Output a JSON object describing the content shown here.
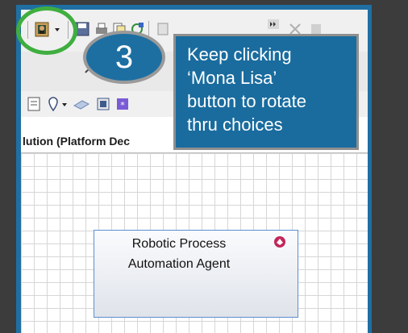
{
  "step": {
    "number": "3"
  },
  "callout": {
    "lines": [
      "Keep clicking",
      "‘Mona Lisa’",
      "button to rotate",
      "thru choices"
    ]
  },
  "diagram": {
    "tab_title": "lution (Platform Dec",
    "node": {
      "lines": [
        "Robotic Process",
        "Automation Agent"
      ]
    }
  },
  "icons": {
    "mona_lisa": "mona-lisa-icon",
    "node_badge": "application-component-icon"
  },
  "colors": {
    "highlight_ring": "#3fae3f",
    "callout_bg": "#1a6c9e",
    "frame": "#1f6fa3",
    "node_badge": "#c3265a"
  }
}
